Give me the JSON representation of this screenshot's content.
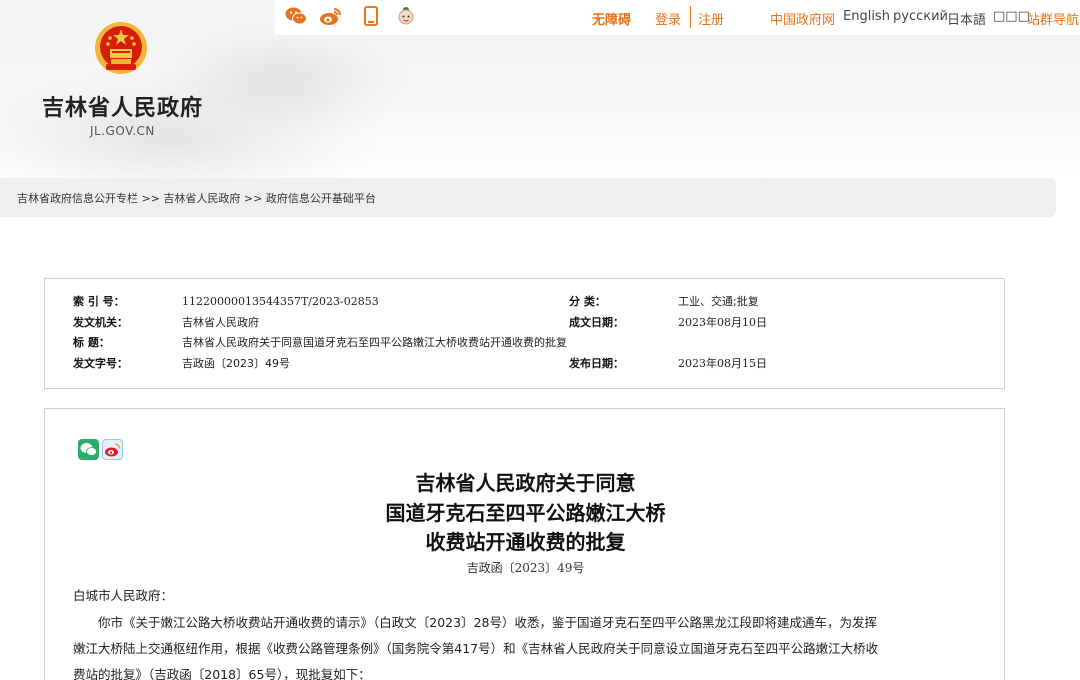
{
  "header": {
    "site_name": "吉林省人民政府",
    "site_domain": "JL.GOV.CN",
    "social_icons": [
      "weixin-icon",
      "weibo-icon",
      "mobile-icon",
      "robot-icon"
    ],
    "accessibility": "无障碍",
    "login": "登录",
    "register": "注册",
    "gov_portal": "中国政府网",
    "lang_en": "English",
    "lang_ru": "русский",
    "lang_ja": "日本語",
    "lang_ko": "□□□",
    "site_nav": "站群导航",
    "accent_color": "#e8731a"
  },
  "breadcrumb": {
    "text": "吉林省政府信息公开专栏 >> 吉林省人民政府 >> 政府信息公开基础平台"
  },
  "info": {
    "index_label": "索 引 号：",
    "index_value": "11220000013544357T/2023-02853",
    "category_label": "分    类：",
    "category_value": "工业、交通;批复",
    "issuer_label": "发文机关：",
    "issuer_value": "吉林省人民政府",
    "written_label": "成文日期：",
    "written_value": "2023年08月10日",
    "title_label": "标    题：",
    "title_value": "吉林省人民政府关于同意国道牙克石至四平公路嫩江大桥收费站开通收费的批复",
    "docno_label": "发文字号：",
    "docno_value": "吉政函〔2023〕49号",
    "published_label": "发布日期：",
    "published_value": "2023年08月15日"
  },
  "document": {
    "share_icons": [
      "wechat-share-icon",
      "weibo-share-icon"
    ],
    "title_line1": "吉林省人民政府关于同意",
    "title_line2": "国道牙克石至四平公路嫩江大桥",
    "title_line3": "收费站开通收费的批复",
    "doc_number": "吉政函〔2023〕49号",
    "salutation": "白城市人民政府：",
    "body_line1": "你市《关于嫩江公路大桥收费站开通收费的请示》（白政文〔2023〕28号）收悉，鉴于国道牙克石至四平公路黑龙江段即将建成通车，为发挥",
    "body_line2": "嫩江大桥陆上交通枢纽作用，根据《收费公路管理条例》（国务院令第417号）和《吉林省人民政府关于同意设立国道牙克石至四平公路嫩江大桥收",
    "body_line3": "费站的批复》（吉政函〔2018〕65号），现批复如下："
  }
}
